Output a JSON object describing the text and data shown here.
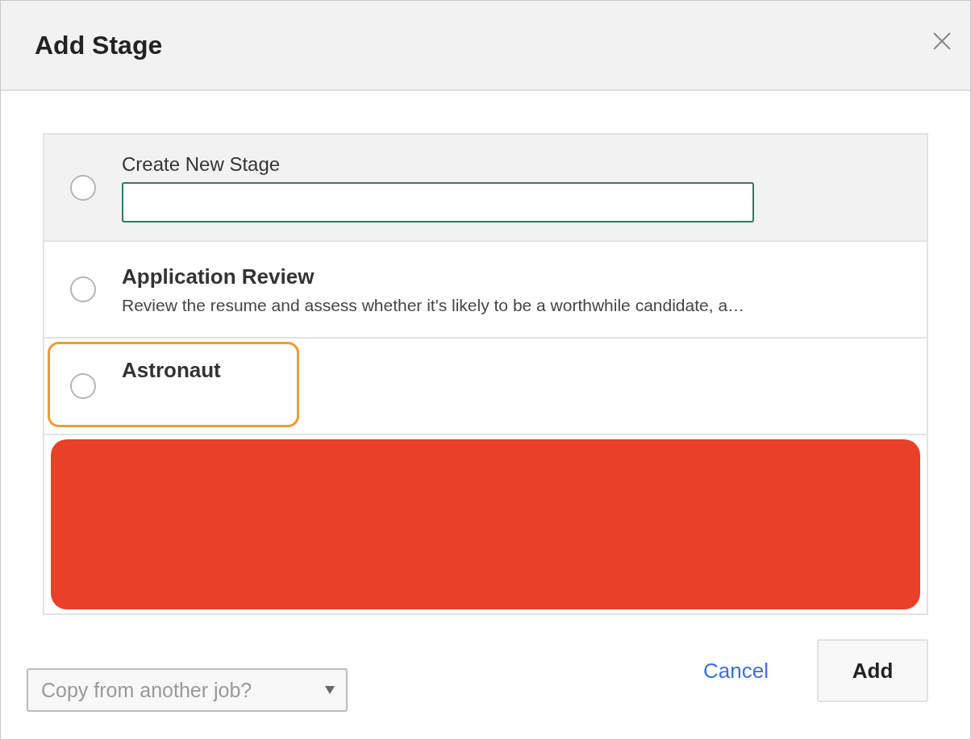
{
  "dialog": {
    "title": "Add Stage"
  },
  "create_stage": {
    "label": "Create New Stage",
    "selected": false
  },
  "stages": [
    {
      "title": "Application Review",
      "description": "Review the resume and assess whether it's likely to be a worthwhile candidate, a…",
      "selected": false,
      "focused": false
    },
    {
      "title": "Astronaut",
      "selected": false,
      "focused": true
    }
  ],
  "footer": {
    "copy_dropdown": {
      "placeholder": "Copy from another job?"
    },
    "cancel": "Cancel",
    "add": "Add"
  }
}
